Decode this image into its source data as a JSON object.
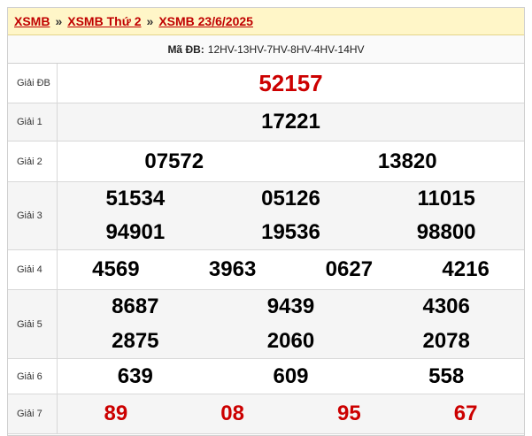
{
  "breadcrumb": {
    "items": [
      "XSMB",
      "XSMB Thứ 2",
      "XSMB 23/6/2025"
    ],
    "separator": "»"
  },
  "ma_db": {
    "label": "Mã ĐB:",
    "value": "12HV-13HV-7HV-8HV-4HV-14HV"
  },
  "prizes": {
    "db": {
      "label": "Giải ĐB",
      "numbers": [
        "52157"
      ]
    },
    "g1": {
      "label": "Giải 1",
      "numbers": [
        "17221"
      ]
    },
    "g2": {
      "label": "Giải 2",
      "numbers": [
        "07572",
        "13820"
      ]
    },
    "g3": {
      "label": "Giải 3",
      "numbers": [
        "51534",
        "05126",
        "11015",
        "94901",
        "19536",
        "98800"
      ]
    },
    "g4": {
      "label": "Giải 4",
      "numbers": [
        "4569",
        "3963",
        "0627",
        "4216"
      ]
    },
    "g5": {
      "label": "Giải 5",
      "numbers": [
        "8687",
        "9439",
        "4306",
        "2875",
        "2060",
        "2078"
      ]
    },
    "g6": {
      "label": "Giải 6",
      "numbers": [
        "639",
        "609",
        "558"
      ]
    },
    "g7": {
      "label": "Giải 7",
      "numbers": [
        "89",
        "08",
        "95",
        "67"
      ]
    }
  },
  "colors": {
    "highlight_red": "#cc0000",
    "breadcrumb_bg": "#fff6c8"
  }
}
